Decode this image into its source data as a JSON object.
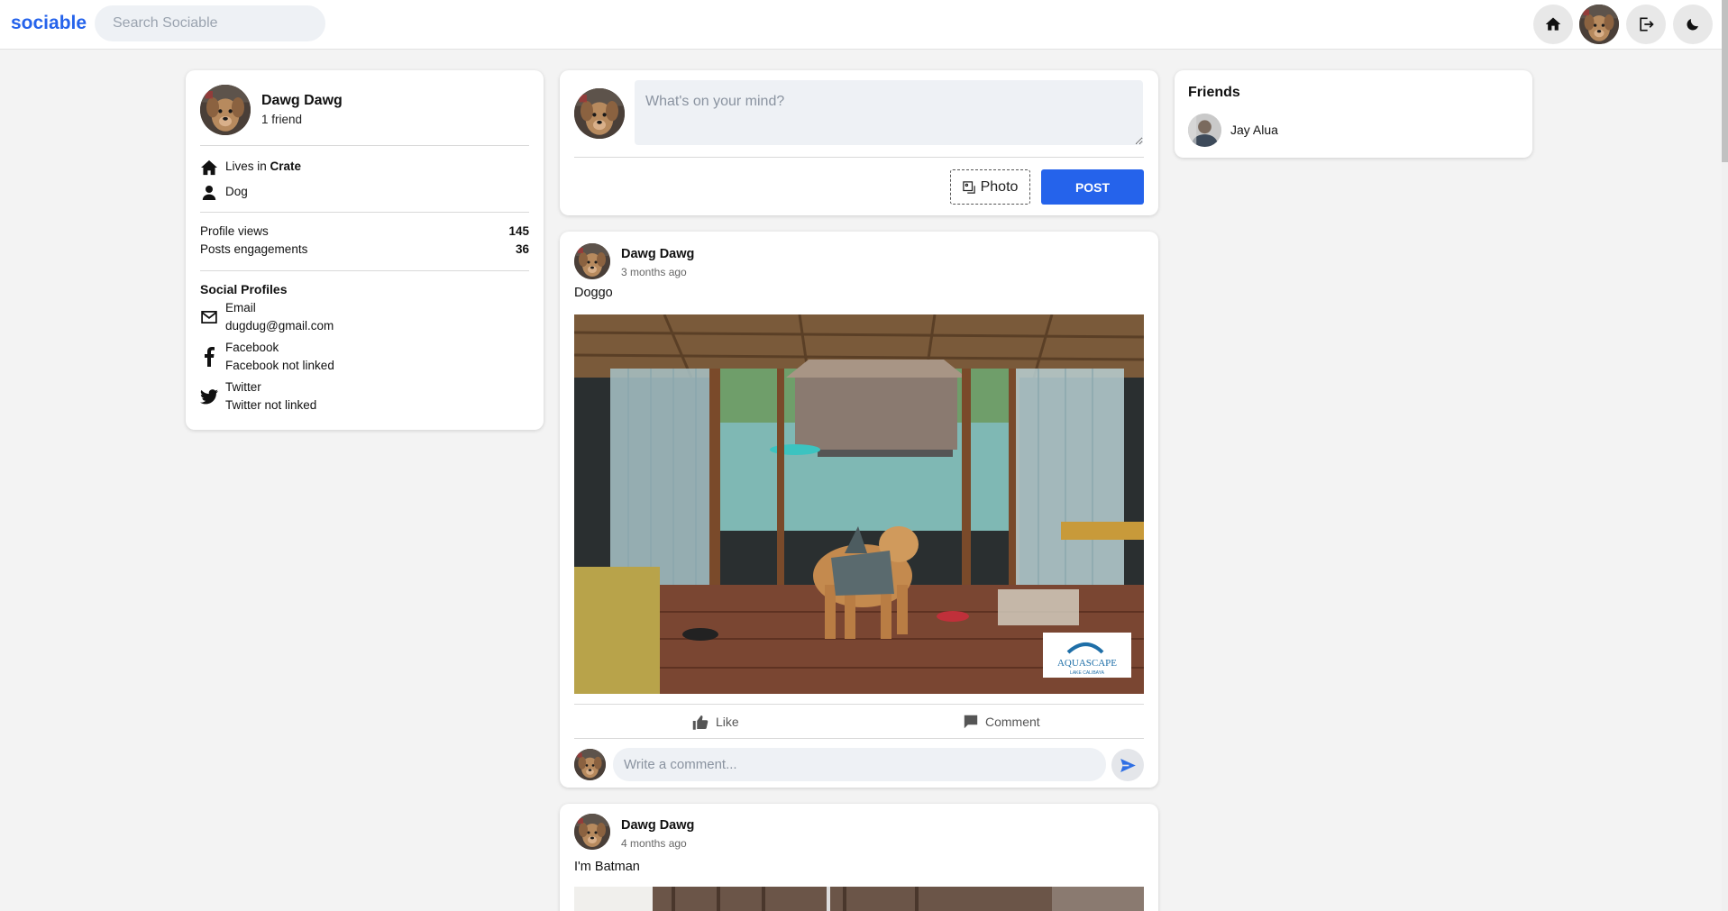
{
  "header": {
    "brand": "sociable",
    "search_placeholder": "Search Sociable",
    "icons": [
      "home-icon",
      "avatar",
      "logout-icon",
      "moon-icon"
    ]
  },
  "profile": {
    "name": "Dawg Dawg",
    "friends": "1 friend",
    "lives_prefix": "Lives in ",
    "lives_place": "Crate",
    "occupation": "Dog",
    "stats": [
      {
        "label": "Profile views",
        "value": "145"
      },
      {
        "label": "Posts engagements",
        "value": "36"
      }
    ],
    "social_title": "Social Profiles",
    "social": [
      {
        "name": "Email",
        "value": "dugdug@gmail.com",
        "icon": "mail-icon"
      },
      {
        "name": "Facebook",
        "value": "Facebook not linked",
        "icon": "facebook-icon"
      },
      {
        "name": "Twitter",
        "value": "Twitter not linked",
        "icon": "twitter-icon"
      }
    ]
  },
  "composer": {
    "placeholder": "What's on your mind?",
    "photo_label": "Photo",
    "post_label": "POST"
  },
  "posts": [
    {
      "author": "Dawg Dawg",
      "time": "3 months ago",
      "body": "Doggo",
      "image_watermark": "AQUASCAPE",
      "image_watermark_sub": "LAKE CALIBAYA",
      "like_label": "Like",
      "comment_label": "Comment",
      "comment_placeholder": "Write a comment..."
    },
    {
      "author": "Dawg Dawg",
      "time": "4 months ago",
      "body": "I'm Batman"
    }
  ],
  "friends": {
    "title": "Friends",
    "list": [
      {
        "name": "Jay Alua"
      }
    ]
  },
  "colors": {
    "accent": "#2563eb",
    "background": "#f3f3f3"
  }
}
